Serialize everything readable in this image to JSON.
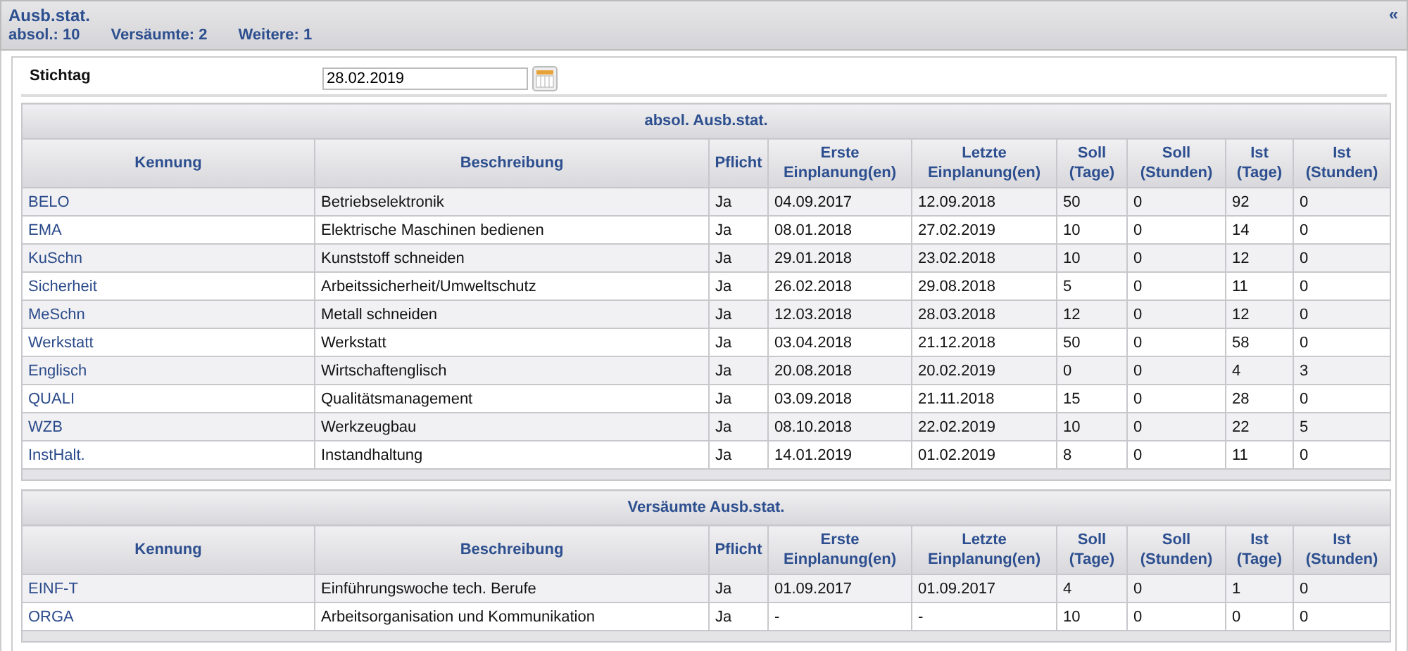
{
  "header": {
    "title": "Ausb.stat.",
    "counts": [
      "absol.: 10",
      "Versäumte: 2",
      "Weitere: 1"
    ],
    "collapse": "«"
  },
  "stichtag": {
    "label": "Stichtag",
    "value": "28.02.2019"
  },
  "tables": [
    {
      "title": "absol. Ausb.stat.",
      "columns": [
        "Kennung",
        "Beschreibung",
        "Pflicht",
        "Erste\nEinplanung(en)",
        "Letzte\nEinplanung(en)",
        "Soll\n(Tage)",
        "Soll\n(Stunden)",
        "Ist\n(Tage)",
        "Ist\n(Stunden)"
      ],
      "rows": [
        [
          "BELO",
          "Betriebselektronik",
          "Ja",
          "04.09.2017",
          "12.09.2018",
          "50",
          "0",
          "92",
          "0"
        ],
        [
          "EMA",
          "Elektrische Maschinen bedienen",
          "Ja",
          "08.01.2018",
          "27.02.2019",
          "10",
          "0",
          "14",
          "0"
        ],
        [
          "KuSchn",
          "Kunststoff schneiden",
          "Ja",
          "29.01.2018",
          "23.02.2018",
          "10",
          "0",
          "12",
          "0"
        ],
        [
          "Sicherheit",
          "Arbeitssicherheit/Umweltschutz",
          "Ja",
          "26.02.2018",
          "29.08.2018",
          "5",
          "0",
          "11",
          "0"
        ],
        [
          "MeSchn",
          "Metall schneiden",
          "Ja",
          "12.03.2018",
          "28.03.2018",
          "12",
          "0",
          "12",
          "0"
        ],
        [
          "Werkstatt",
          "Werkstatt",
          "Ja",
          "03.04.2018",
          "21.12.2018",
          "50",
          "0",
          "58",
          "0"
        ],
        [
          "Englisch",
          "Wirtschaftenglisch",
          "Ja",
          "20.08.2018",
          "20.02.2019",
          "0",
          "0",
          "4",
          "3"
        ],
        [
          "QUALI",
          "Qualitätsmanagement",
          "Ja",
          "03.09.2018",
          "21.11.2018",
          "15",
          "0",
          "28",
          "0"
        ],
        [
          "WZB",
          "Werkzeugbau",
          "Ja",
          "08.10.2018",
          "22.02.2019",
          "10",
          "0",
          "22",
          "5"
        ],
        [
          "InstHalt.",
          "Instandhaltung",
          "Ja",
          "14.01.2019",
          "01.02.2019",
          "8",
          "0",
          "11",
          "0"
        ]
      ]
    },
    {
      "title": "Versäumte Ausb.stat.",
      "columns": [
        "Kennung",
        "Beschreibung",
        "Pflicht",
        "Erste\nEinplanung(en)",
        "Letzte\nEinplanung(en)",
        "Soll\n(Tage)",
        "Soll\n(Stunden)",
        "Ist\n(Tage)",
        "Ist\n(Stunden)"
      ],
      "rows": [
        [
          "EINF-T",
          "Einführungswoche tech. Berufe",
          "Ja",
          "01.09.2017",
          "01.09.2017",
          "4",
          "0",
          "1",
          "0"
        ],
        [
          "ORGA",
          "Arbeitsorganisation und Kommunikation",
          "Ja",
          "-",
          "-",
          "10",
          "0",
          "0",
          "0"
        ]
      ]
    }
  ]
}
